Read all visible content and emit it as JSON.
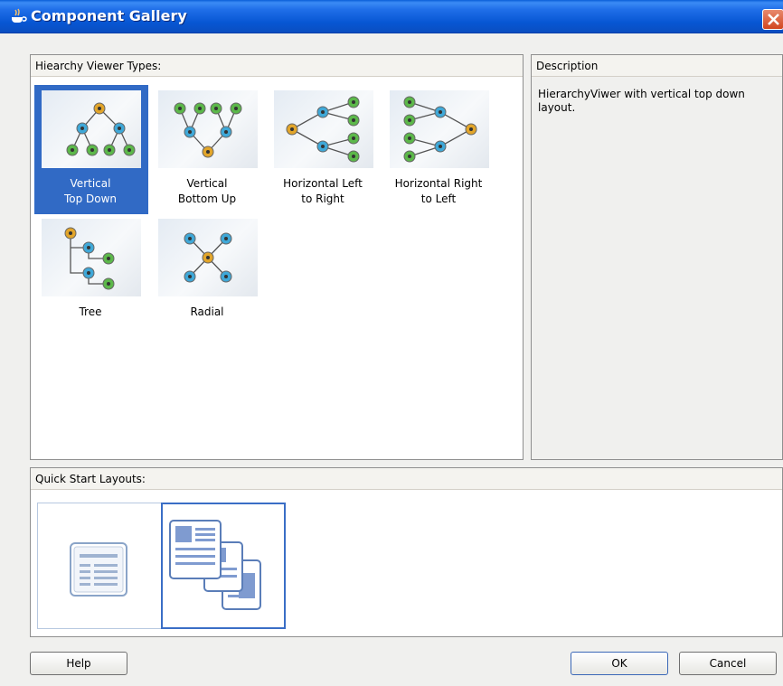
{
  "window": {
    "title": "Component Gallery",
    "app_icon": "cup-icon",
    "close_icon": "close-icon"
  },
  "types": {
    "header": "Hiearchy Viewer Types:",
    "items": [
      {
        "label_line1": "Vertical",
        "label_line2": "Top Down",
        "selected": true
      },
      {
        "label_line1": "Vertical",
        "label_line2": "Bottom Up",
        "selected": false
      },
      {
        "label_line1": "Horizontal Left",
        "label_line2": "to Right",
        "selected": false
      },
      {
        "label_line1": "Horizontal Right",
        "label_line2": "to Left",
        "selected": false
      },
      {
        "label_line1": "Tree",
        "label_line2": "",
        "selected": false
      },
      {
        "label_line1": "Radial",
        "label_line2": "",
        "selected": false
      }
    ]
  },
  "description": {
    "header": "Description",
    "text": "HierarchyViwer with vertical top down layout."
  },
  "quick_start": {
    "header": "Quick Start Layouts:",
    "items": [
      {
        "icon": "single-page-layout-icon",
        "selected": false
      },
      {
        "icon": "stacked-pages-layout-icon",
        "selected": true
      }
    ]
  },
  "buttons": {
    "help": "Help",
    "ok": "OK",
    "cancel": "Cancel"
  },
  "colors": {
    "title_bar": "#0a5fd8",
    "selection": "#316ac5",
    "node_root": "#e2a52a",
    "node_mid": "#3fa8d8",
    "node_leaf": "#5cb84a"
  }
}
